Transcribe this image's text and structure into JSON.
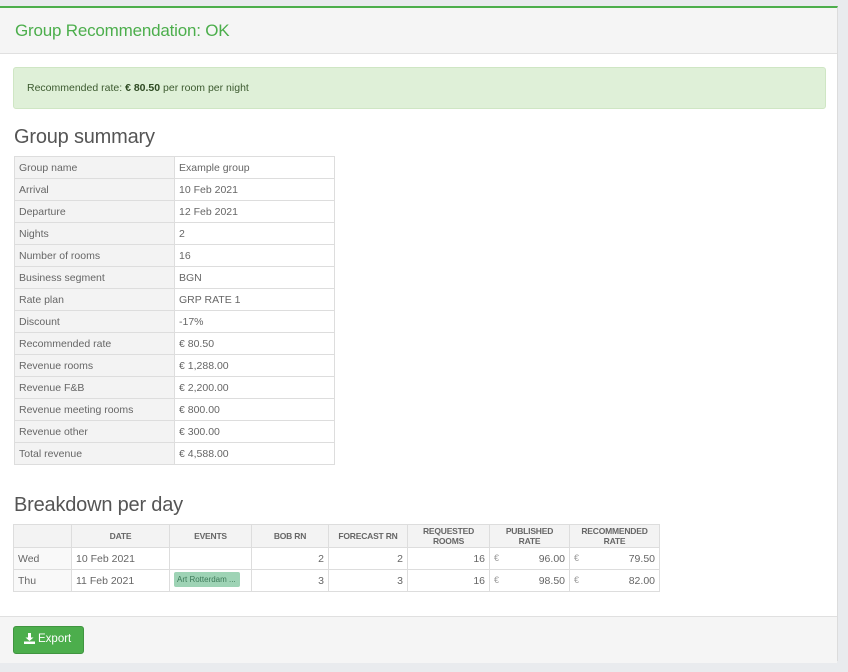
{
  "header": {
    "title": "Group Recommendation: OK"
  },
  "alert": {
    "prefix": "Recommended rate: ",
    "value": "€ 80.50",
    "suffix": " per room per night"
  },
  "summary": {
    "heading": "Group summary",
    "rows": [
      {
        "label": "Group name",
        "value": "Example group"
      },
      {
        "label": "Arrival",
        "value": "10 Feb 2021"
      },
      {
        "label": "Departure",
        "value": "12 Feb 2021"
      },
      {
        "label": "Nights",
        "value": "2"
      },
      {
        "label": "Number of rooms",
        "value": "16"
      },
      {
        "label": "Business segment",
        "value": "BGN"
      },
      {
        "label": "Rate plan",
        "value": "GRP RATE 1"
      },
      {
        "label": "Discount",
        "value": "-17%"
      },
      {
        "label": "Recommended rate",
        "value": "€ 80.50"
      },
      {
        "label": "Revenue rooms",
        "value": "€ 1,288.00"
      },
      {
        "label": "Revenue F&B",
        "value": "€ 2,200.00"
      },
      {
        "label": "Revenue meeting rooms",
        "value": "€ 800.00"
      },
      {
        "label": "Revenue other",
        "value": "€ 300.00"
      },
      {
        "label": "Total revenue",
        "value": "€ 4,588.00"
      }
    ]
  },
  "breakdown": {
    "heading": "Breakdown per day",
    "columns": [
      "",
      "DATE",
      "EVENTS",
      "BOB RN",
      "FORECAST RN",
      "REQUESTED ROOMS",
      "PUBLISHED RATE",
      "RECOMMENDED RATE"
    ],
    "currency": "€",
    "rows": [
      {
        "day": "Wed",
        "date": "10 Feb 2021",
        "event": "",
        "bob": "2",
        "forecast": "2",
        "requested": "16",
        "published": "96.00",
        "recommended": "79.50"
      },
      {
        "day": "Thu",
        "date": "11 Feb 2021",
        "event": "Art Rotterdam ...",
        "bob": "3",
        "forecast": "3",
        "requested": "16",
        "published": "98.50",
        "recommended": "82.00"
      }
    ]
  },
  "footer": {
    "export_label": "Export",
    "export_icon": "download-icon"
  },
  "colors": {
    "accent": "#4cae4c",
    "alert_bg": "#dff0d8",
    "event_tag": "#9ed3b5"
  }
}
